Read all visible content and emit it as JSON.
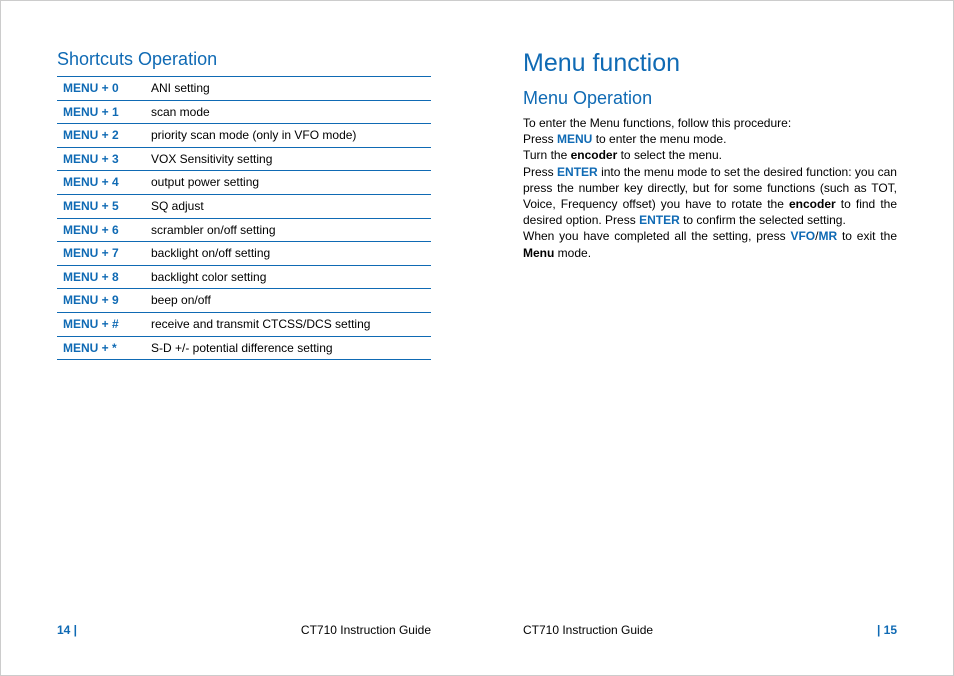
{
  "left": {
    "heading": "Shortcuts Operation",
    "menuLabel": "MENU",
    "shortcuts": [
      {
        "key": "+ 0",
        "desc": "ANI setting"
      },
      {
        "key": "+ 1",
        "desc": "scan mode"
      },
      {
        "key": "+ 2",
        "desc": "priority scan mode (only in VFO mode)"
      },
      {
        "key": "+ 3",
        "desc": "VOX Sensitivity setting"
      },
      {
        "key": "+ 4",
        "desc": "output power setting"
      },
      {
        "key": "+ 5",
        "desc": " SQ adjust"
      },
      {
        "key": "+ 6",
        "desc": "scrambler on/off setting"
      },
      {
        "key": "+ 7",
        "desc": "backlight on/off setting"
      },
      {
        "key": "+ 8",
        "desc": "backlight color setting"
      },
      {
        "key": "+ 9",
        "desc": "beep on/off"
      },
      {
        "key": "+ #",
        "desc": "receive and transmit CTCSS/DCS setting"
      },
      {
        "key": "+ *",
        "desc": "S-D +/- potential difference setting"
      }
    ],
    "footerPage": "14 |",
    "footerGuide": "CT710 Instruction Guide"
  },
  "right": {
    "title": "Menu function",
    "subheading": "Menu Operation",
    "para": {
      "l1a": "To enter the Menu functions, follow this procedure:",
      "l2a": "Press ",
      "l2b": "MENU",
      "l2c": " to enter the menu mode.",
      "l3a": "Turn the ",
      "l3b": "encoder",
      "l3c": " to select the menu.",
      "l4a": "Press ",
      "l4b": "ENTER",
      "l4c": " into the menu mode to set the desired function: you can press the number key directly, but for some functions (such as TOT, Voice, Frequency offset) you have to rotate the ",
      "l4d": "encoder",
      "l4e": " to find the desired option. Press ",
      "l4f": "ENTER",
      "l4g": " to confirm the selected setting.",
      "l5a": "When you have completed all the setting, press ",
      "l5b": "VFO",
      "l5c": "/",
      "l5d": "MR",
      "l5e": " to exit the ",
      "l5f": "Menu",
      "l5g": " mode."
    },
    "footerGuide": "CT710 Instruction Guide",
    "footerPage": "| 15"
  }
}
